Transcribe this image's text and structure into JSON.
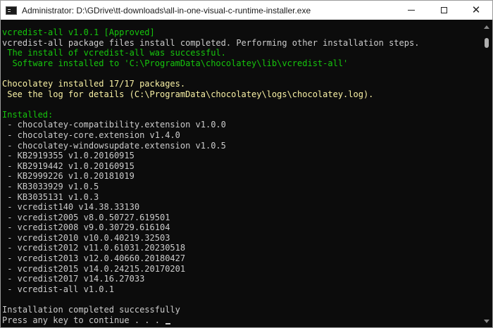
{
  "window": {
    "title": "Administrator: D:\\GDrive\\tt-downloads\\all-in-one-visual-c-runtime-installer.exe",
    "icon": "terminal-icon",
    "controls": {
      "minimize": "minimize-icon",
      "maximize": "maximize-icon",
      "close": "✕"
    }
  },
  "colors": {
    "background": "#0c0c0c",
    "green": "#16c60c",
    "yellow": "#f9f1a5",
    "text": "#cccccc"
  },
  "console": {
    "lines": [
      "vcredist-all v1.0.1 [Approved]",
      "vcredist-all package files install completed. Performing other installation steps.",
      " The install of vcredist-all was successful.",
      "  Software installed to 'C:\\ProgramData\\chocolatey\\lib\\vcredist-all'",
      "",
      "Chocolatey installed 17/17 packages.",
      " See the log for details (C:\\ProgramData\\chocolatey\\logs\\chocolatey.log).",
      "",
      "Installed:",
      " - chocolatey-compatibility.extension v1.0.0",
      " - chocolatey-core.extension v1.4.0",
      " - chocolatey-windowsupdate.extension v1.0.5",
      " - KB2919355 v1.0.20160915",
      " - KB2919442 v1.0.20160915",
      " - KB2999226 v1.0.20181019",
      " - KB3033929 v1.0.5",
      " - KB3035131 v1.0.3",
      " - vcredist140 v14.38.33130",
      " - vcredist2005 v8.0.50727.619501",
      " - vcredist2008 v9.0.30729.616104",
      " - vcredist2010 v10.0.40219.32503",
      " - vcredist2012 v11.0.61031.20230518",
      " - vcredist2013 v12.0.40660.20180427",
      " - vcredist2015 v14.0.24215.20170201",
      " - vcredist2017 v14.16.27033",
      " - vcredist-all v1.0.1",
      "",
      "Installation completed successfully",
      "Press any key to continue . . . "
    ],
    "line_colors": [
      "green",
      "white",
      "green",
      "green",
      "white",
      "yellow",
      "yellow",
      "white",
      "green",
      "white",
      "white",
      "white",
      "white",
      "white",
      "white",
      "white",
      "white",
      "white",
      "white",
      "white",
      "white",
      "white",
      "white",
      "white",
      "white",
      "white",
      "white",
      "white",
      "white"
    ]
  }
}
